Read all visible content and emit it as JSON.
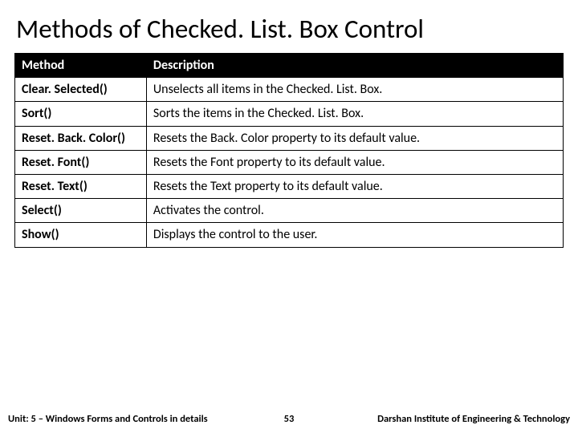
{
  "title": "Methods of Checked. List. Box Control",
  "table": {
    "headers": [
      "Method",
      "Description"
    ],
    "rows": [
      {
        "method": "Clear. Selected()",
        "desc": "Unselects all items in the Checked. List. Box."
      },
      {
        "method": "Sort()",
        "desc": "Sorts the items in the Checked. List. Box."
      },
      {
        "method": "Reset. Back. Color()",
        "desc": "Resets the Back. Color property to its default value."
      },
      {
        "method": "Reset. Font()",
        "desc": "Resets the Font property to its default value."
      },
      {
        "method": "Reset. Text()",
        "desc": "Resets the Text property to its default value."
      },
      {
        "method": "Select()",
        "desc": "Activates the control."
      },
      {
        "method": "Show()",
        "desc": "Displays the control to the user."
      }
    ]
  },
  "footer": {
    "left": "Unit: 5 – Windows Forms and Controls in details",
    "page": "53",
    "right": "Darshan Institute of Engineering & Technology"
  }
}
